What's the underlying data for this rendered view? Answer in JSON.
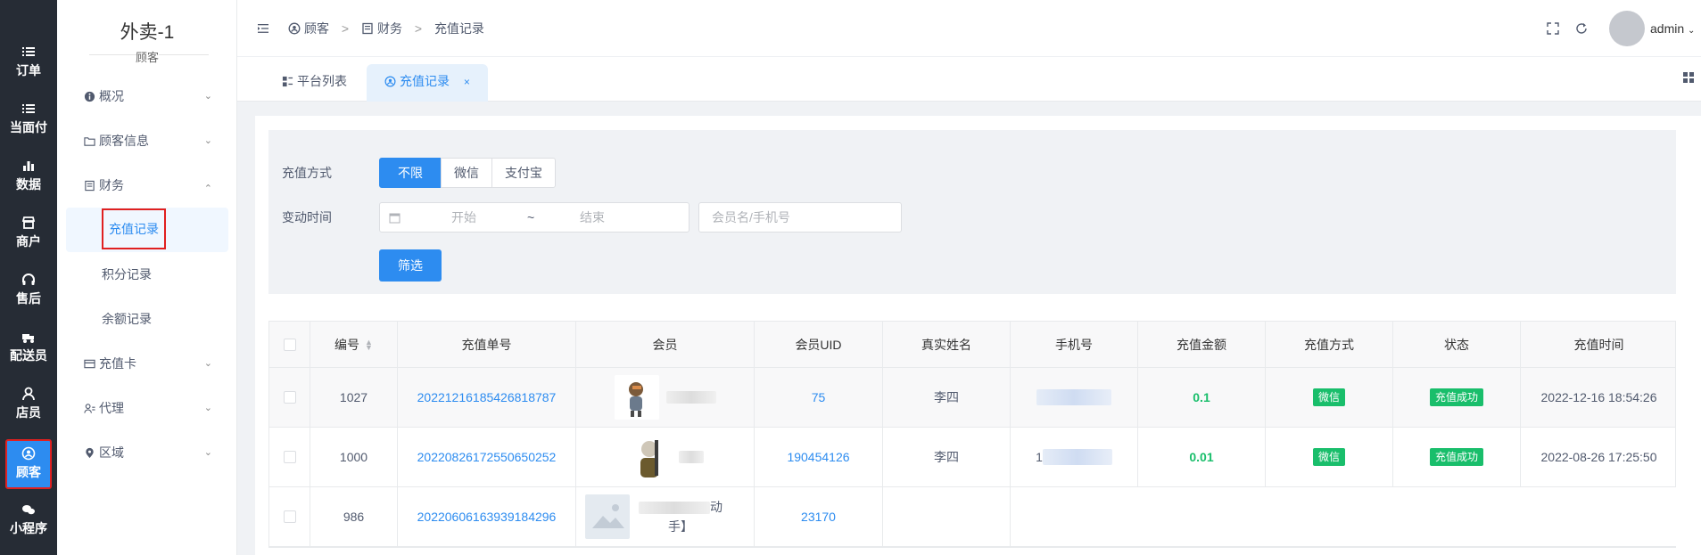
{
  "rail": [
    {
      "label": "订单",
      "icon": "list-icon"
    },
    {
      "label": "当面付",
      "icon": "list-icon"
    },
    {
      "label": "数据",
      "icon": "bar-chart-icon"
    },
    {
      "label": "商户",
      "icon": "store-icon"
    },
    {
      "label": "售后",
      "icon": "headset-icon"
    },
    {
      "label": "配送员",
      "icon": "delivery-icon"
    },
    {
      "label": "店员",
      "icon": "person-icon"
    },
    {
      "label": "顾客",
      "icon": "customer-icon",
      "active": true
    },
    {
      "label": "小程序",
      "icon": "wechat-icon"
    }
  ],
  "sidebar": {
    "store_name": "外卖-1",
    "section": "顾客",
    "menu": [
      {
        "label": "概况",
        "icon": "info-icon",
        "expanded": false
      },
      {
        "label": "顾客信息",
        "icon": "folder-icon",
        "expanded": false
      },
      {
        "label": "财务",
        "icon": "finance-icon",
        "expanded": true
      },
      {
        "label": "充值卡",
        "icon": "card-icon",
        "expanded": false
      },
      {
        "label": "代理",
        "icon": "agent-icon",
        "expanded": false
      },
      {
        "label": "区域",
        "icon": "location-icon",
        "expanded": false
      }
    ],
    "finance_children": [
      "充值记录",
      "积分记录",
      "余额记录"
    ],
    "active_child": "充值记录"
  },
  "header": {
    "breadcrumb": [
      "顾客",
      "财务",
      "充值记录"
    ],
    "separator": ">",
    "user": "admin"
  },
  "tabs": [
    {
      "label": "平台列表",
      "active": false
    },
    {
      "label": "充值记录",
      "active": true,
      "close": "×"
    }
  ],
  "filter": {
    "method_label": "充值方式",
    "methods": [
      "不限",
      "微信",
      "支付宝"
    ],
    "selected_method": "不限",
    "time_label": "变动时间",
    "start_placeholder": "开始",
    "range_sep": "~",
    "end_placeholder": "结束",
    "search_placeholder": "会员名/手机号",
    "submit": "筛选"
  },
  "table": {
    "columns": [
      "编号",
      "充值单号",
      "会员",
      "会员UID",
      "真实姓名",
      "手机号",
      "充值金额",
      "充值方式",
      "状态",
      "充值时间"
    ],
    "rows": [
      {
        "id": "1027",
        "order_no": "20221216185426818787",
        "uid": "75",
        "real_name": "李四",
        "amount": "0.1",
        "method": "微信",
        "status": "充值成功",
        "time": "2022-12-16 18:54:26"
      },
      {
        "id": "1000",
        "order_no": "20220826172550650252",
        "uid": "190454126",
        "real_name": "李四",
        "phone_prefix": "1",
        "amount": "0.01",
        "method": "微信",
        "status": "充值成功",
        "time": "2022-08-26 17:25:50"
      },
      {
        "id": "986",
        "order_no": "20220606163939184296",
        "uid": "23170",
        "member_tail": "手】",
        "member_partial": "动"
      }
    ]
  },
  "colors": {
    "primary": "#2d8cf0",
    "success": "#19be6b",
    "rail": "#262c35",
    "highlight": "#e02020"
  }
}
